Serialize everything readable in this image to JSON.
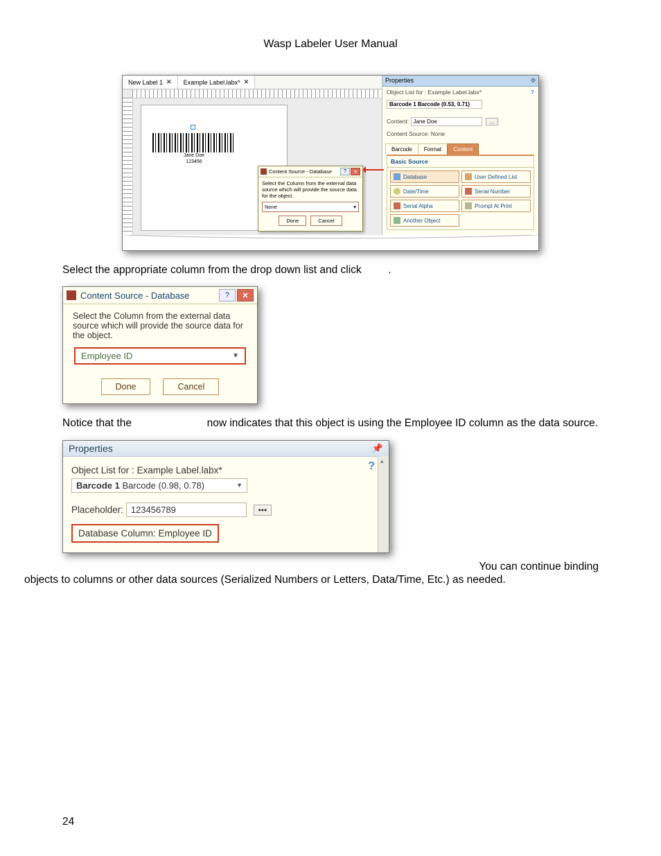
{
  "page_title": "Wasp Labeler User Manual",
  "page_number": "24",
  "shot1": {
    "tab1": "New Label 1",
    "tab2": "Example Label.labx*",
    "barcode_name": "Jane Doe",
    "barcode_code": "123456",
    "mini_dialog": {
      "title": "Content Source - Database",
      "text": "Select the Column from the external data source which will provide the source data for the object.",
      "value": "None",
      "done": "Done",
      "cancel": "Cancel"
    },
    "props": {
      "title": "Properties",
      "objlist": "Object List for :  Example Label.labx*",
      "ddl": "Barcode 1 Barcode (0.53, 0.71)",
      "content_lbl": "Content:",
      "content_val": "Jane Doe",
      "src": "Content Source: None",
      "tab_barcode": "Barcode",
      "tab_format": "Format",
      "tab_content": "Content",
      "bs_head": "Basic Source",
      "i_db": "Database",
      "i_udl": "User Defined List",
      "i_dt": "Date/Time",
      "i_sn": "Serial Number",
      "i_sa": "Serial Alpha",
      "i_pp": "Prompt At Print",
      "i_ao": "Another Object"
    }
  },
  "line1a": "Select the appropriate column from the drop down list and click ",
  "line1b": ".",
  "shot2": {
    "title": "Content Source - Database",
    "text": "Select the Column from the external data source which will provide the source data for the object.",
    "value": "Employee ID",
    "done": "Done",
    "cancel": "Cancel"
  },
  "line2a": "Notice that the ",
  "line2b": "now indicates that this object is using the Employee ID column as the data source.",
  "shot3": {
    "title": "Properties",
    "objlist": "Object List for :  Example Label.labx*",
    "ddl": "Barcode 1 Barcode (0.98, 0.78)",
    "ph_lbl": "Placeholder:",
    "ph_val": "123456789",
    "box": "Database Column: Employee ID"
  },
  "line3": "You can continue binding objects to columns or other data sources (Serialized Numbers or Letters, Data/Time, Etc.) as needed."
}
